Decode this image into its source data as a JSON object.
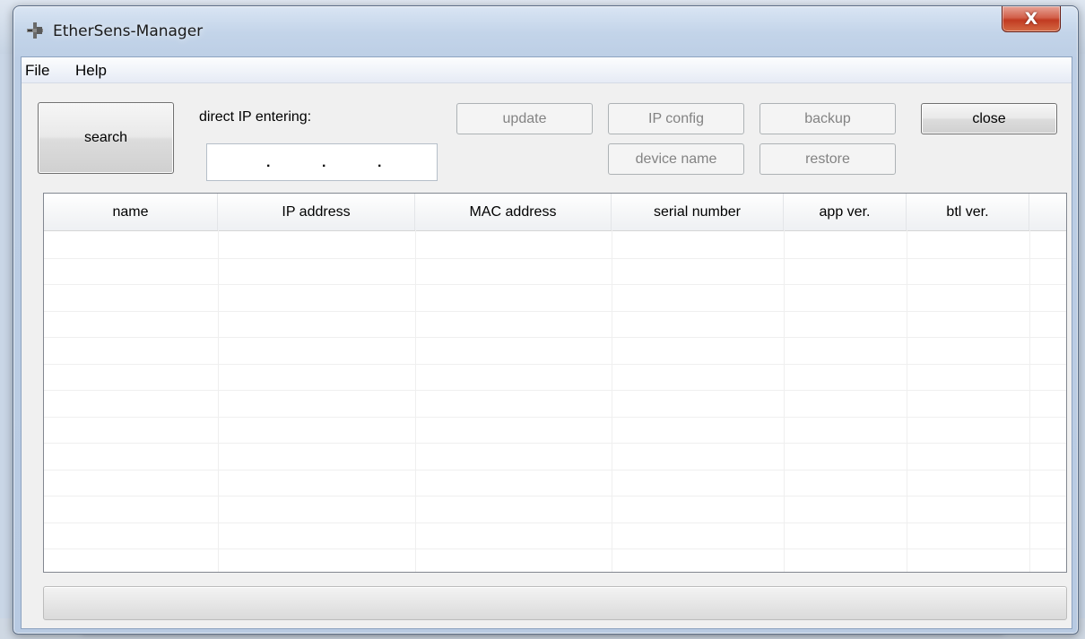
{
  "window": {
    "title": "EtherSens-Manager",
    "close_glyph": "X",
    "icon": "network-plug-icon"
  },
  "menu": [
    "File",
    "Help"
  ],
  "toolbar": {
    "search_label": "search",
    "ip_label": "direct IP entering:",
    "ip_dots": [
      ".",
      ".",
      "."
    ],
    "update_label": "update",
    "ip_config_label": "IP config",
    "backup_label": "backup",
    "close_label": "close",
    "device_name_label": "device name",
    "restore_label": "restore"
  },
  "table": {
    "columns": [
      "name",
      "IP address",
      "MAC address",
      "serial number",
      "app ver.",
      "btl ver."
    ],
    "rows": []
  },
  "progress": {
    "value": 0
  }
}
